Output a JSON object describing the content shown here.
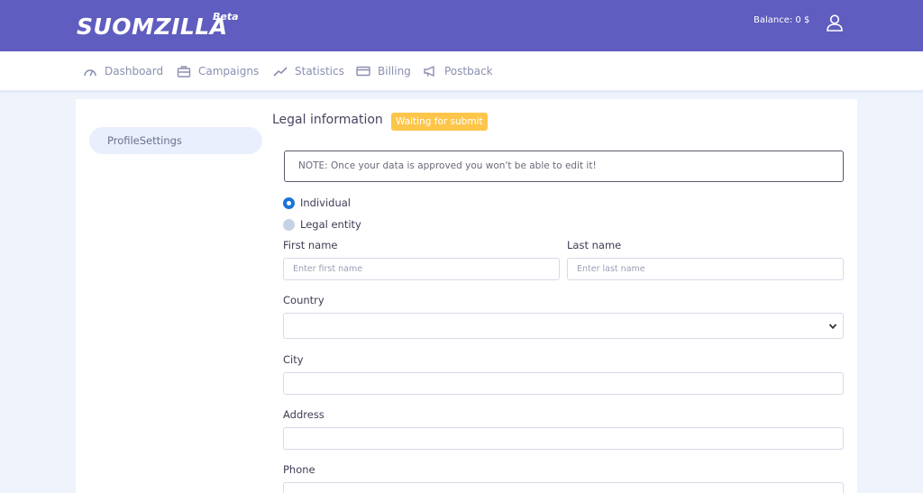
{
  "header": {
    "logo_text": "SUOMZILLA",
    "logo_badge": "Beta",
    "balance": "Balance: 0 $",
    "user_icon": "user-icon"
  },
  "nav": {
    "items": [
      {
        "label": "Dashboard",
        "icon": "gauge-icon"
      },
      {
        "label": "Campaigns",
        "icon": "briefcase-icon"
      },
      {
        "label": "Statistics",
        "icon": "trend-icon"
      },
      {
        "label": "Billing",
        "icon": "card-icon"
      },
      {
        "label": "Postback",
        "icon": "megaphone-icon"
      }
    ]
  },
  "sidebar": {
    "items": [
      {
        "label": "ProfileSettings"
      }
    ]
  },
  "form": {
    "title": "Legal information",
    "status_badge": "Waiting for submit",
    "note": "NOTE: Once your data is approved you won't be able to edit it!",
    "type_options": [
      {
        "label": "Individual",
        "checked": true
      },
      {
        "label": "Legal entity",
        "checked": false
      }
    ],
    "first_name": {
      "label": "First name",
      "placeholder": "Enter first name",
      "value": ""
    },
    "last_name": {
      "label": "Last name",
      "placeholder": "Enter last name",
      "value": ""
    },
    "country": {
      "label": "Country",
      "value": ""
    },
    "city": {
      "label": "City",
      "value": ""
    },
    "address": {
      "label": "Address",
      "value": ""
    },
    "phone": {
      "label": "Phone",
      "value": ""
    }
  },
  "colors": {
    "topbar": "#5f5dbf",
    "badge": "#fdc64a",
    "radio_checked": "#1a75d6",
    "page_bg": "#eef3fc"
  }
}
